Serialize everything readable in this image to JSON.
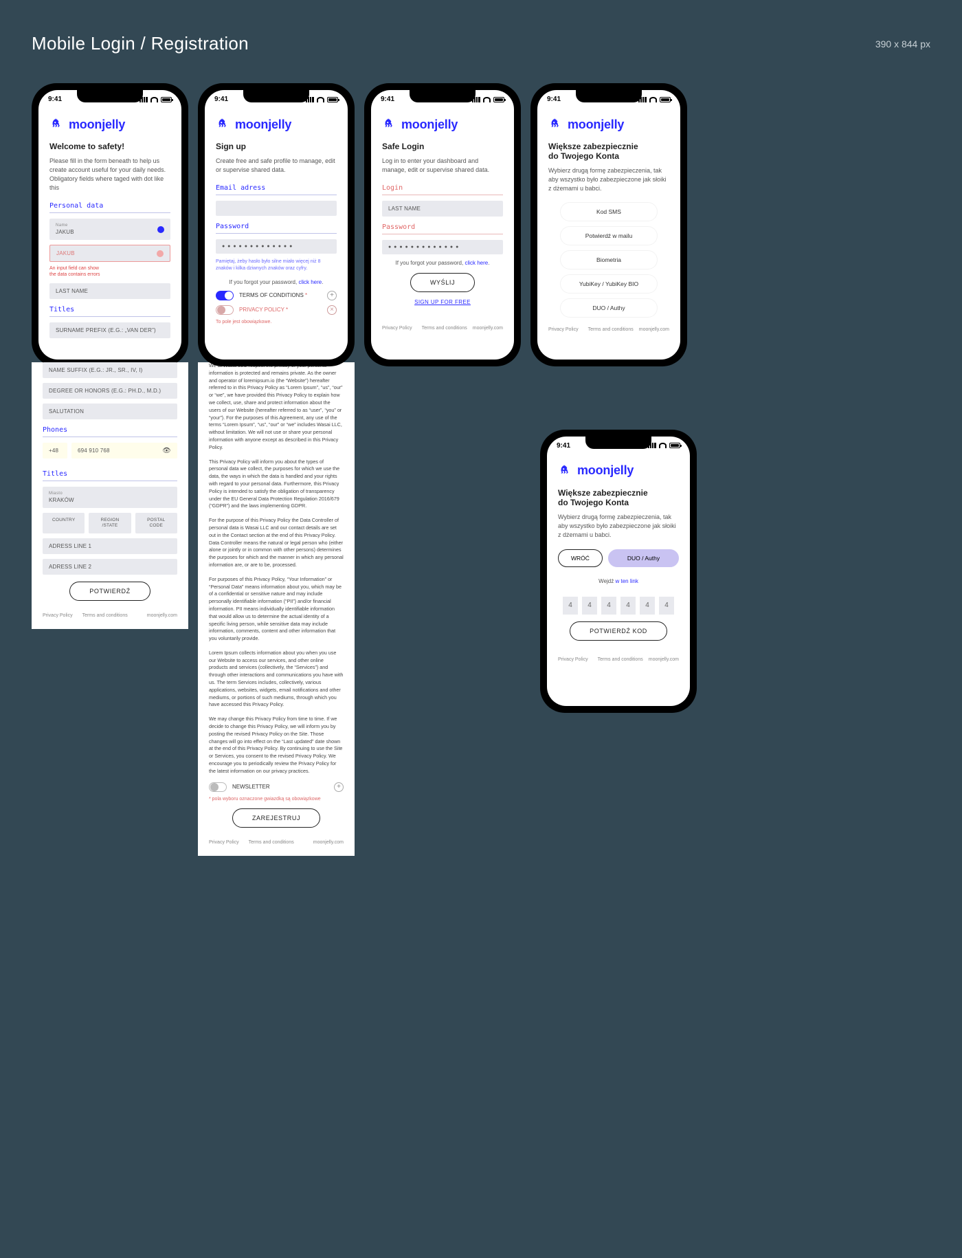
{
  "header": {
    "title": "Mobile Login / Registration",
    "dims": "390 x 844 px"
  },
  "brand": "moonjelly",
  "status_time": "9:41",
  "footer": {
    "privacy": "Privacy Policy",
    "terms": "Terms and conditions",
    "site": "moonjelly.com"
  },
  "screen1": {
    "heading": "Welcome to safety!",
    "lead": "Please fill in the form beneath to help us create account useful for your daily needs. Obligatory fields where taged with dot like this",
    "section_personal": "Personal data",
    "name_label": "Name",
    "name_value": "JAKUB",
    "name_error_value": "JAKUB",
    "error_line1": "An input field can show",
    "error_line2": "the data contains errors",
    "last_name": "LAST NAME",
    "section_titles": "Titles",
    "surname_prefix": "SURNAME PREFIX (E.G.: „VAN DER”)",
    "name_suffix": "NAME SUFFIX (E.G.: JR., SR., IV, I)",
    "degree": "DEGREE OR HONORS (E.G.: PH.D., M.D.)",
    "salutation": "SALUTATION",
    "section_phones": "Phones",
    "phone_cc": "+48",
    "phone_num": "694 910 768",
    "miasto_label": "Miasto",
    "miasto_value": "KRAKÓW",
    "country": "COUNTRY",
    "region": "REGION /STATE",
    "postal": "POSTAL CODE",
    "addr1": "ADRESS LINE 1",
    "addr2": "ADRESS LINE 2",
    "submit": "POTWIERDŹ"
  },
  "screen2": {
    "heading": "Sign up",
    "lead": "Create free and safe profile to manage, edit or supervise shared data.",
    "email_label": "Email adress",
    "pass_label": "Password",
    "pass_mask": "● ● ● ● ● ● ● ● ● ● ● ● ●",
    "pass_hint": "Pamiętaj, żeby hasło było silne miało więcej niż 8 znaków i kilka dziwnych znaków oraz cyfry.",
    "forgot_pre": "If you forgot your password, ",
    "forgot_link": "click here",
    "terms": "TERMS OF CONDITIONS",
    "privacy": "PRIVACY POLICY",
    "req_field": "To pole jest obowiązkowe.",
    "p1": "We at Wasai LLC respect the privacy of your personal information is protected and remains private. As the owner and operator of loremipsum.io (the “Website”) hereafter referred to in this Privacy Policy as “Lorem Ipsum”, “us”, “our” or “we”, we have provided this Privacy Policy to explain how we collect, use, share and protect information about the users of our Website (hereafter referred to as “user”, “you” or “your”). For the purposes of this Agreement, any use of the terms “Lorem Ipsum”, “us”, “our” or “we” includes Wasai LLC, without limitation. We will not use or share your personal information with anyone except as described in this Privacy Policy.",
    "p2": "This Privacy Policy will inform you about the types of personal data we collect, the purposes for which we use the data, the ways in which the data is handled and your rights with regard to your personal data. Furthermore, this Privacy Policy is intended to satisfy the obligation of transparency under the EU General Data Protection Regulation 2016/679 (“GDPR”) and the laws implementing GDPR.",
    "p3": "For the purpose of this Privacy Policy the Data Controller of personal data is Wasai LLC and our contact details are set out in the Contact section at the end of this Privacy Policy. Data Controller means the natural or legal person who (either alone or jointly or in common with other persons) determines the purposes for which and the manner in which any personal information are, or are to be, processed.",
    "p4": "For purposes of this Privacy Policy, “Your Information” or “Personal Data” means information about you, which may be of a confidential or sensitive nature and may include personally identifiable information (“PII”) and/or financial information. PII means individually identifiable information that would allow us to determine the actual identity of a specific living person, while sensitive data may include information, comments, content and other information that you voluntarily provide.",
    "p5": "Lorem Ipsum collects information about you when you use our Website to access our services, and other online products and services (collectively, the “Services”) and through other interactions and communications you have with us. The term Services includes, collectively, various applications, websites, widgets, email notifications and other mediums, or portions of such mediums, through which you have accessed this Privacy Policy.",
    "p6": "We may change this Privacy Policy from time to time. If we decide to change this Privacy Policy, we will inform you by posting the revised Privacy Policy on the Site. Those changes will go into effect on the “Last updated” date shown at the end of this Privacy Policy. By continuing to use the Site or Services, you consent to the revised Privacy Policy. We encourage you to periodically review the Privacy Policy for the latest information on our privacy practices.",
    "newsletter": "NEWSLETTER",
    "req_note": "* pola wyboru oznaczone gwiazdką są obowiązkowe",
    "submit": "ZAREJESTRUJ"
  },
  "screen3": {
    "heading": "Safe Login",
    "lead": "Log in to enter your dashboard and manage, edit or supervise shared data.",
    "login_label": "Login",
    "login_value": "LAST NAME",
    "pass_label": "Password",
    "pass_mask": "● ● ● ● ● ● ● ● ● ● ● ● ●",
    "forgot_pre": "If you forgot your password, ",
    "forgot_link": "click here",
    "submit": "WYŚLIJ",
    "signup": "SIGN UP FOR FREE"
  },
  "screen4": {
    "heading1": "Większe zabezpiecznie",
    "heading2": "do Twojego Konta",
    "lead": "Wybierz drugą formę zabezpieczenia, tak aby wszystko było zabezpieczone jak słoiki z dżemami u babci.",
    "opts": [
      "Kod SMS",
      "Potwierdź w mailu",
      "Biometria",
      "YubiKey / YubiKey BIO",
      "DUO / Authy"
    ]
  },
  "screen5": {
    "heading1": "Większe zabezpiecznie",
    "heading2": "do Twojego Konta",
    "lead": "Wybierz drugą formę zabezpieczenia, tak aby wszystko było zabezpieczone jak słoiki z dżemami u babci.",
    "back": "WRÓĆ",
    "method": "DUO / Authy",
    "enter_pre": "Wejdź ",
    "enter_link": "w ten link",
    "code": [
      "4",
      "4",
      "4",
      "4",
      "4",
      "4"
    ],
    "submit": "POTWIERDŹ KOD"
  }
}
